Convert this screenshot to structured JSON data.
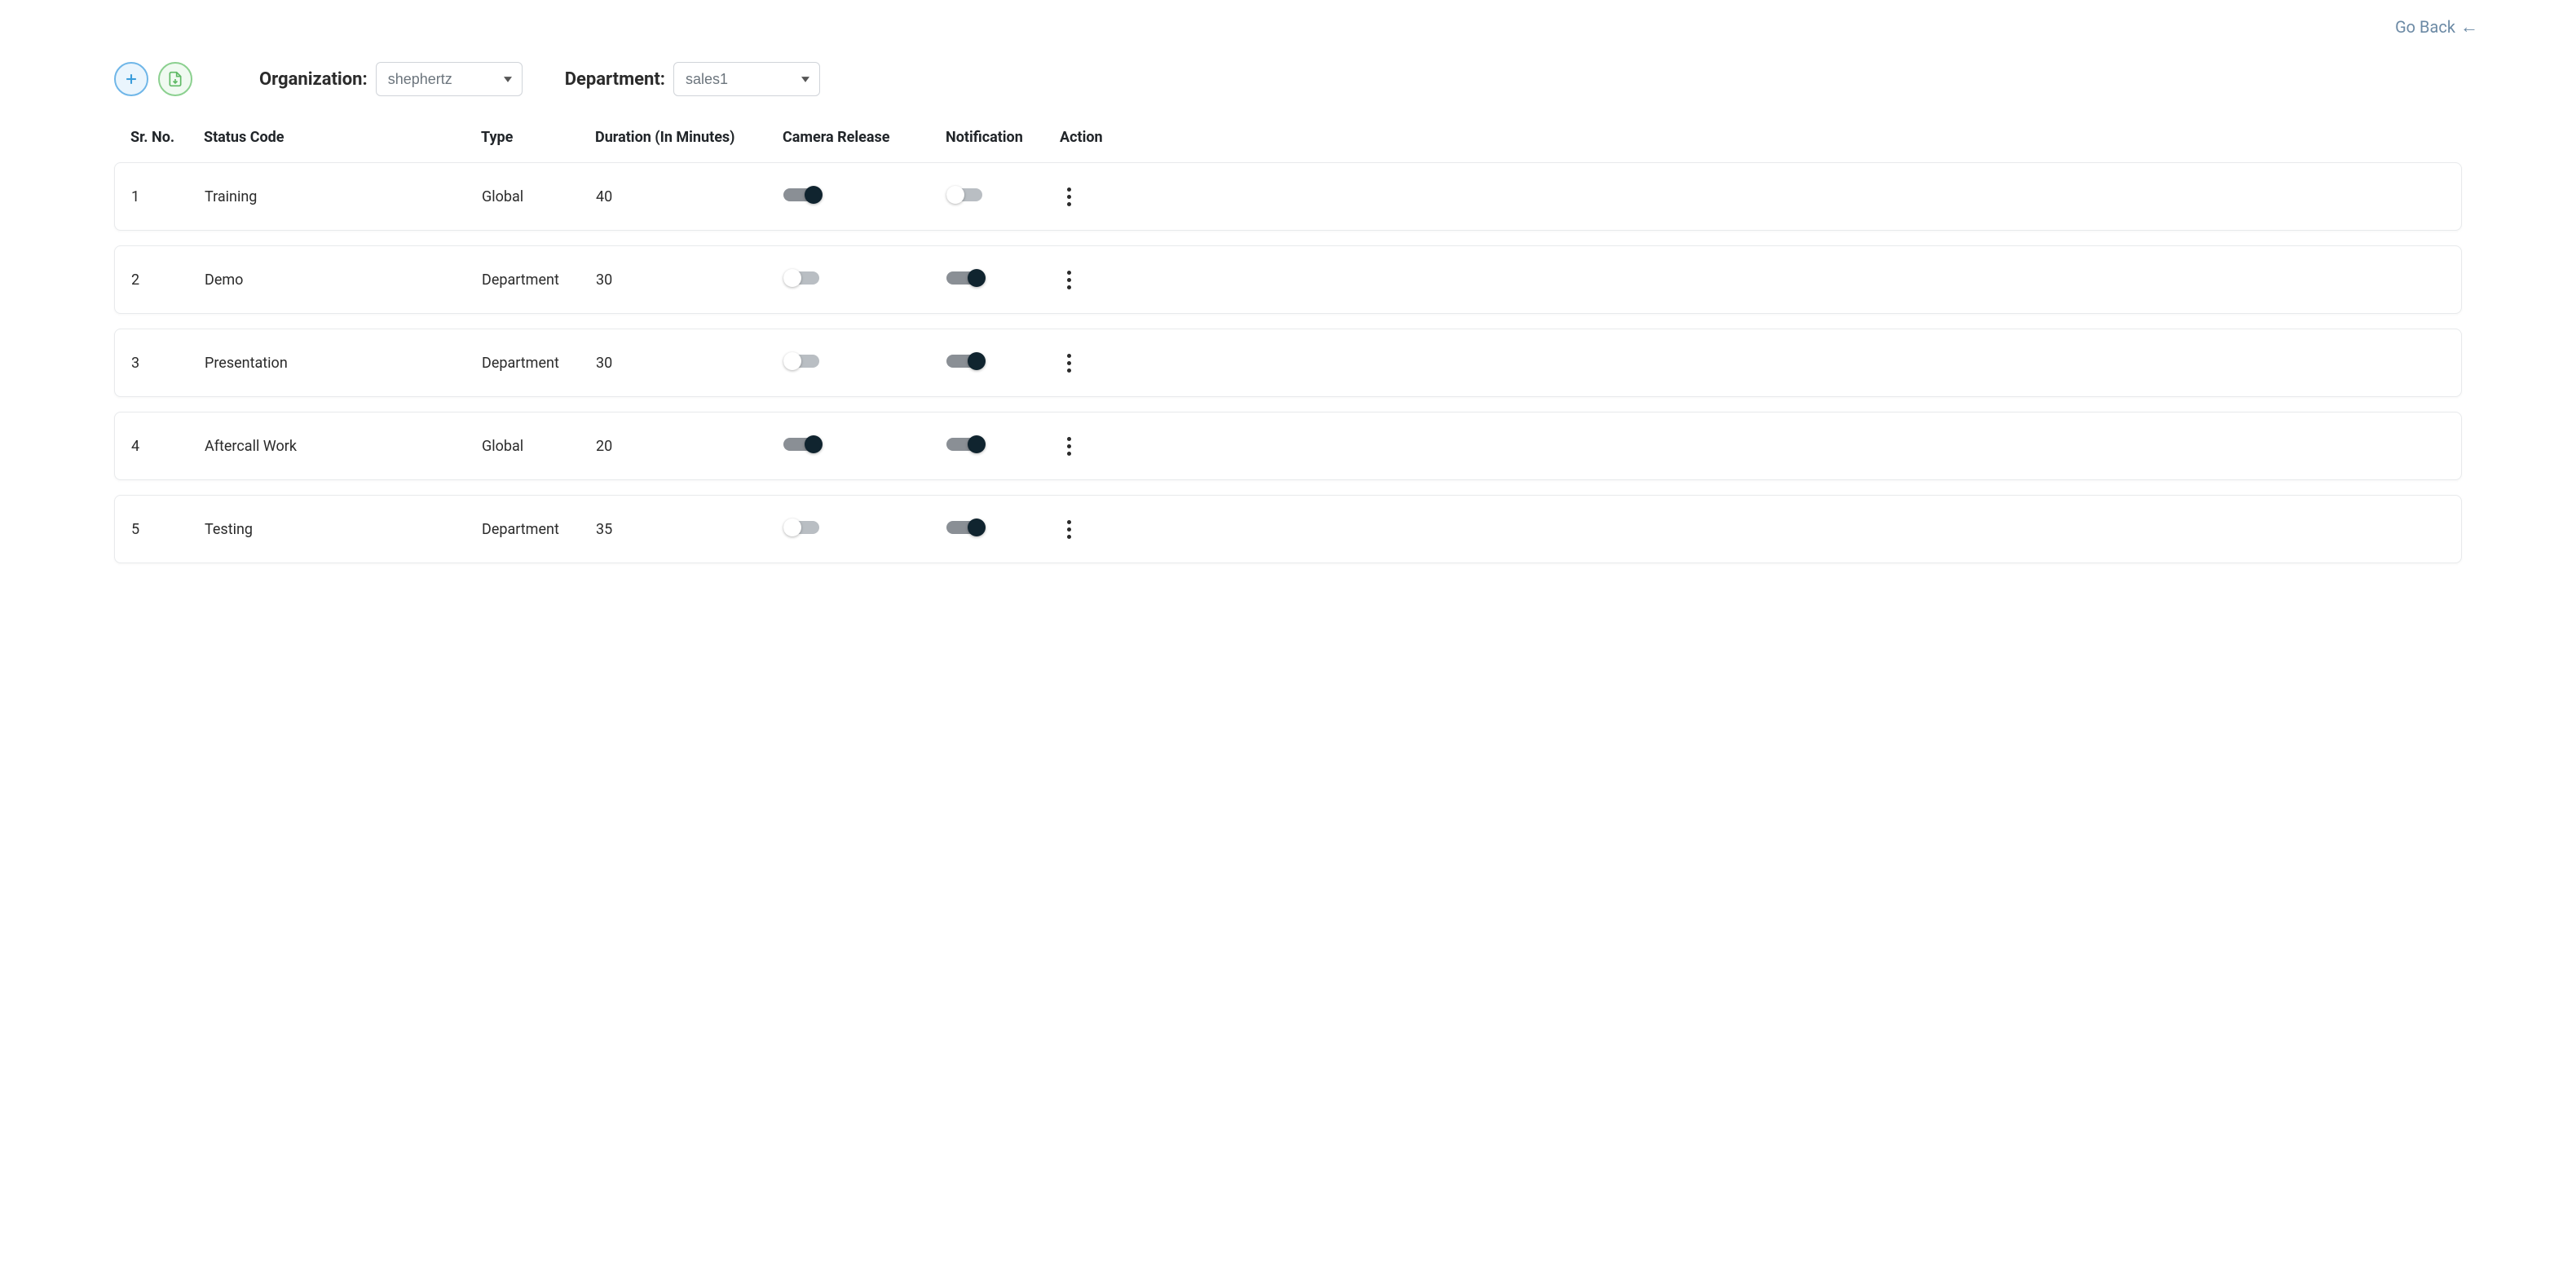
{
  "header": {
    "go_back_label": "Go Back"
  },
  "filters": {
    "organization_label": "Organization:",
    "organization_value": "shephertz",
    "department_label": "Department:",
    "department_value": "sales1"
  },
  "table": {
    "columns": {
      "sr_no": "Sr. No.",
      "status_code": "Status Code",
      "type": "Type",
      "duration": "Duration (In Minutes)",
      "camera_release": "Camera Release",
      "notification": "Notification",
      "action": "Action"
    },
    "rows": [
      {
        "sr_no": "1",
        "status_code": "Training",
        "type": "Global",
        "duration": "40",
        "camera_release": true,
        "notification": false
      },
      {
        "sr_no": "2",
        "status_code": "Demo",
        "type": "Department",
        "duration": "30",
        "camera_release": false,
        "notification": true
      },
      {
        "sr_no": "3",
        "status_code": "Presentation",
        "type": "Department",
        "duration": "30",
        "camera_release": false,
        "notification": true
      },
      {
        "sr_no": "4",
        "status_code": "Aftercall Work",
        "type": "Global",
        "duration": "20",
        "camera_release": true,
        "notification": true
      },
      {
        "sr_no": "5",
        "status_code": "Testing",
        "type": "Department",
        "duration": "35",
        "camera_release": false,
        "notification": true
      }
    ]
  }
}
